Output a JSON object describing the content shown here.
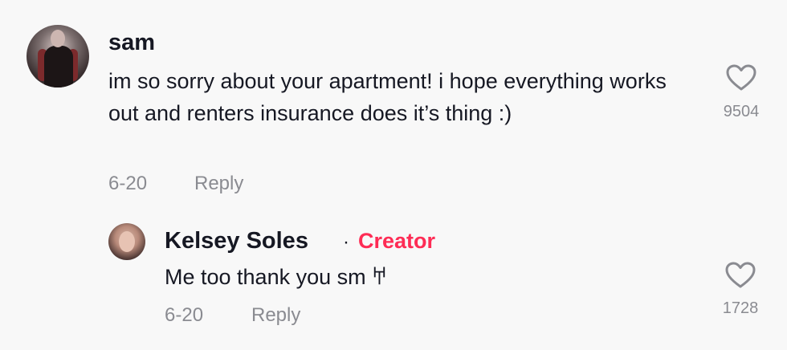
{
  "comment": {
    "username": "sam",
    "text": "im so sorry about your apartment! i hope everything works out and renters insurance does it’s thing :)",
    "date": "6-20",
    "reply_label": "Reply",
    "likes": "9504"
  },
  "reply": {
    "username": "Kelsey Soles",
    "separator": "·",
    "badge": "Creator",
    "text": "Me too thank you sm 𐀀",
    "date": "6-20",
    "reply_label": "Reply",
    "likes": "1728"
  },
  "icons": {
    "like": "heart-outline-icon"
  },
  "colors": {
    "creator_badge": "#fe2c55",
    "meta_text": "#8a8b91",
    "primary_text": "#161823",
    "background": "#f8f8f8"
  }
}
